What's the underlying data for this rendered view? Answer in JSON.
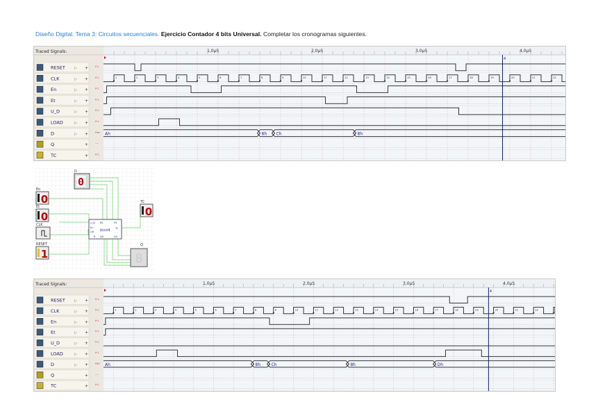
{
  "title": {
    "part1": "Diseño Digital. Tema 3: Circuitos secuenciales.",
    "part2": "Ejercicio Contador 4 bits Universal.",
    "part3": "Completar los cronogramas siguientes."
  },
  "colors": {
    "title_blue": "#2a7fd0",
    "bus_text": "#1a1aa0",
    "cursor": "#1a1a80",
    "marker": "#d01010",
    "grid": "#d09090"
  },
  "timeline": {
    "unit": "µS",
    "tick_labels": [
      "1,0µS",
      "2,0µS",
      "3,0µS",
      "4,0µS"
    ],
    "clock_period_us": 0.2,
    "clock_first_edge_us": 0.1
  },
  "charts": [
    {
      "header": "Traced Signals:",
      "cursor_us": 3.83,
      "cursor_label": "4",
      "clock_edge_labels": [
        "1",
        "2",
        "3",
        "4",
        "5",
        "6",
        "7",
        "8",
        "9",
        "10",
        "11",
        "12",
        "13",
        "14",
        "15",
        "16",
        "17",
        "18",
        "19",
        "20",
        "21",
        "22"
      ],
      "signals": [
        {
          "name": "RESET",
          "icon": "reset-icon",
          "kind": "digital",
          "scale_label": "H L",
          "initial": 1,
          "transitions_us": [
            0.3,
            0.36,
            3.38,
            3.48
          ]
        },
        {
          "name": "CLK",
          "icon": "clock-icon",
          "kind": "clock",
          "scale_label": "H L"
        },
        {
          "name": "En",
          "icon": "input-icon",
          "kind": "digital",
          "scale_label": "H L",
          "initial": 0,
          "transitions_us": [
            0.03,
            0.84,
            1.13,
            2.43,
            2.73
          ]
        },
        {
          "name": "Et",
          "icon": "input-icon",
          "kind": "digital",
          "scale_label": "H L",
          "initial": 0,
          "transitions_us": [
            0.03,
            2.13,
            2.34
          ]
        },
        {
          "name": "U_D",
          "icon": "input-icon",
          "kind": "digital",
          "scale_label": "H L",
          "initial": 0,
          "transitions_us": [
            0.07,
            3.41
          ]
        },
        {
          "name": "LOAD",
          "icon": "input-icon",
          "kind": "digital",
          "scale_label": "H L",
          "initial": 0,
          "transitions_us": [
            0.53,
            0.73
          ]
        },
        {
          "name": "D",
          "icon": "bus-icon",
          "kind": "bus",
          "scale_label": "Hex",
          "segments": [
            {
              "t": 0,
              "v": "Ah"
            },
            {
              "t": 1.49,
              "v": "8h"
            },
            {
              "t": 1.63,
              "v": "Ch"
            },
            {
              "t": 2.41,
              "v": "8h"
            }
          ]
        },
        {
          "name": "Q",
          "icon": "bus-output-icon",
          "kind": "empty",
          "scale_label": "----"
        },
        {
          "name": "TC",
          "icon": "output-icon",
          "kind": "empty",
          "scale_label": "H L"
        }
      ]
    },
    {
      "header": "Traced Signals:",
      "cursor_us": 3.85,
      "cursor_label": "4",
      "clock_edge_labels": [
        "1",
        "2",
        "3",
        "4",
        "5",
        "6",
        "7",
        "8",
        "9",
        "10",
        "11",
        "12",
        "13",
        "14",
        "15",
        "16",
        "17",
        "18",
        "19",
        "20",
        "21",
        "22"
      ],
      "signals": [
        {
          "name": "RESET",
          "icon": "reset-icon",
          "kind": "digital",
          "scale_label": "H L",
          "initial": 1,
          "transitions_us": [
            3.46,
            3.64
          ]
        },
        {
          "name": "CLK",
          "icon": "clock-icon",
          "kind": "clock",
          "scale_label": "H L"
        },
        {
          "name": "En",
          "icon": "input-icon",
          "kind": "digital",
          "scale_label": "H L",
          "initial": 0,
          "transitions_us": [
            0.02,
            1.66,
            2.06
          ]
        },
        {
          "name": "Et",
          "icon": "input-icon",
          "kind": "digital",
          "scale_label": "H L",
          "initial": 0,
          "transitions_us": [
            0.02
          ]
        },
        {
          "name": "U_D",
          "icon": "input-icon",
          "kind": "digital",
          "scale_label": "H L",
          "initial": 0,
          "transitions_us": []
        },
        {
          "name": "LOAD",
          "icon": "input-icon",
          "kind": "digital",
          "scale_label": "H L",
          "initial": 0,
          "transitions_us": [
            0.53,
            0.74,
            3.42,
            3.78
          ]
        },
        {
          "name": "D",
          "icon": "bus-icon",
          "kind": "bus",
          "scale_label": "Hex",
          "segments": [
            {
              "t": 0,
              "v": "Ah"
            },
            {
              "t": 1.49,
              "v": "8h"
            },
            {
              "t": 1.65,
              "v": "Ch"
            },
            {
              "t": 2.44,
              "v": "8h"
            },
            {
              "t": 3.31,
              "v": "Dh"
            }
          ]
        },
        {
          "name": "Q",
          "icon": "bus-output-icon",
          "kind": "empty",
          "scale_label": "----"
        },
        {
          "name": "TC",
          "icon": "output-icon",
          "kind": "empty",
          "scale_label": "H L"
        }
      ]
    }
  ],
  "circuit": {
    "d_display": "0",
    "input_labels": [
      "En",
      "Et",
      "CLK",
      "RESET"
    ],
    "input_values": [
      "0",
      "0",
      "",
      "1"
    ],
    "d_label": "D",
    "tc_label": "TC",
    "tc_value": "0",
    "q_label": "Q",
    "q_display": "8",
    "counter_name": "Ucnt4",
    "counter_pins": [
      "U_D",
      "P0",
      "P3",
      "En",
      "Et",
      "Clk",
      "Q0",
      "Q3",
      "TC",
      "R"
    ]
  }
}
